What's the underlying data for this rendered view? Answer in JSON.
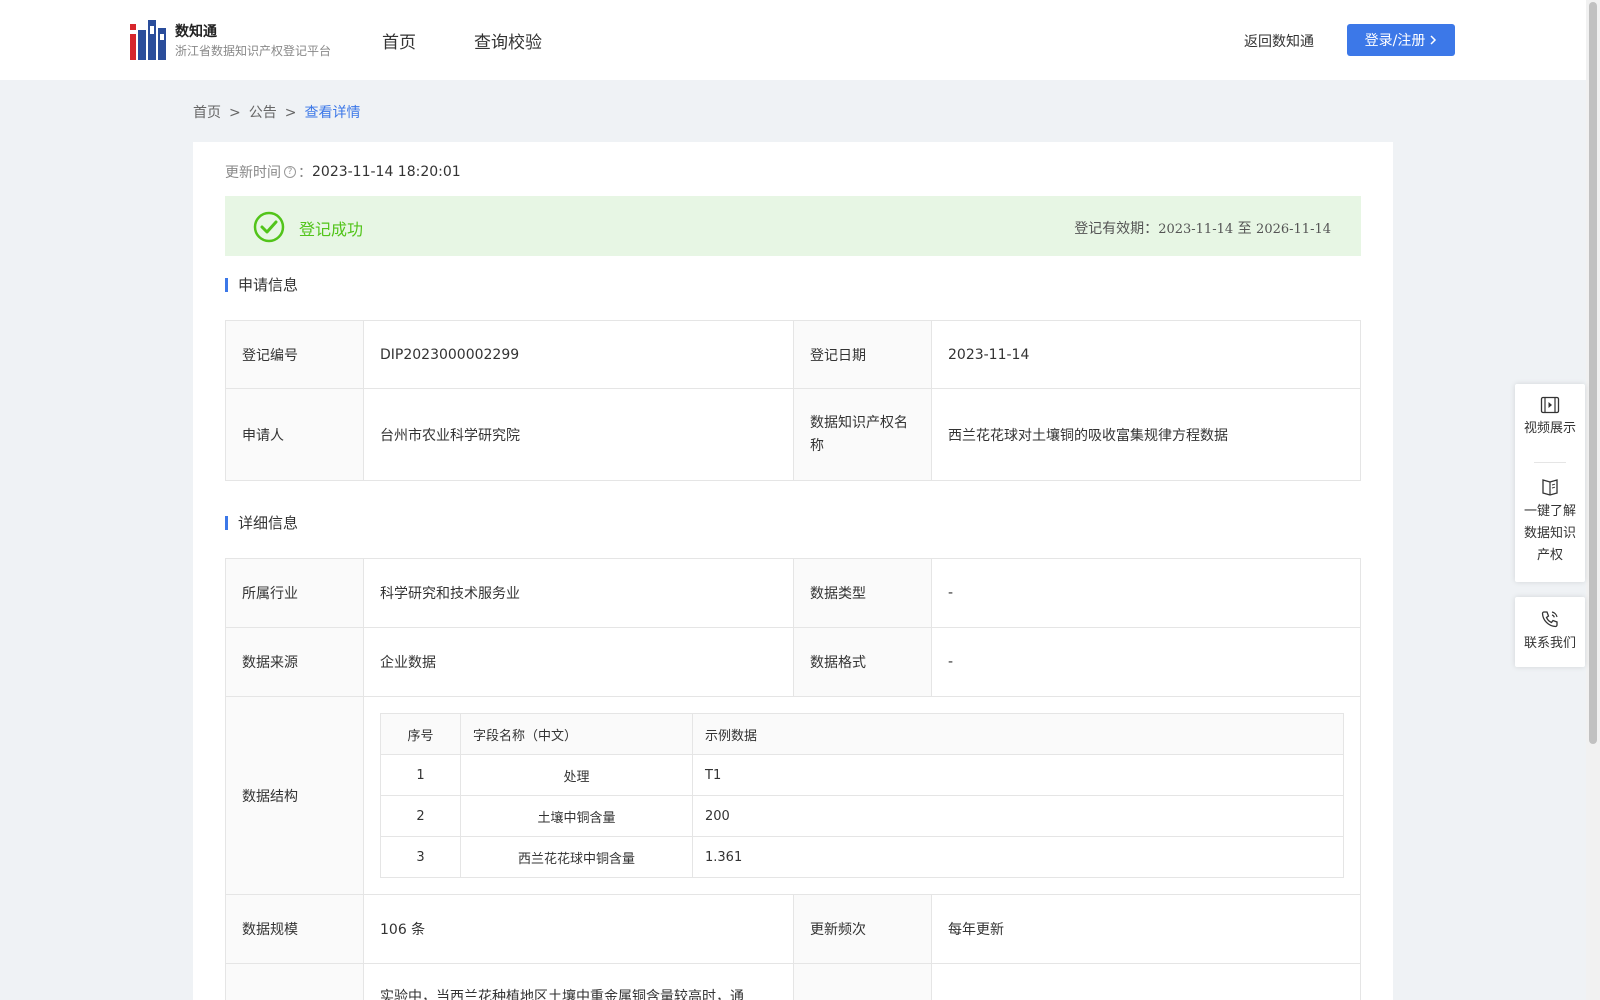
{
  "header": {
    "brand_name": "数知通",
    "brand_sub": "浙江省数据知识产权登记平台",
    "nav": [
      "首页",
      "查询校验"
    ],
    "back_link": "返回数知通",
    "login_label": "登录/注册"
  },
  "breadcrumb": [
    "首页",
    "公告",
    "查看详情"
  ],
  "update": {
    "label": "更新时间",
    "value": "2023-11-14 18:20:01"
  },
  "status": {
    "text": "登记成功",
    "validity_label": "登记有效期：",
    "validity_from": "2023-11-14",
    "validity_to_word": "至",
    "validity_to": "2026-11-14"
  },
  "sections": {
    "apply": "申请信息",
    "detail": "详细信息"
  },
  "apply_info": {
    "reg_no_label": "登记编号",
    "reg_no": "DIP2023000002299",
    "reg_date_label": "登记日期",
    "reg_date": "2023-11-14",
    "applicant_label": "申请人",
    "applicant": "台州市农业科学研究院",
    "name_label": "数据知识产权名称",
    "name": "西兰花花球对土壤铜的吸收富集规律方程数据"
  },
  "detail_info": {
    "industry_label": "所属行业",
    "industry": "科学研究和技术服务业",
    "type_label": "数据类型",
    "type": "-",
    "source_label": "数据来源",
    "source": "企业数据",
    "format_label": "数据格式",
    "format": "-",
    "structure_label": "数据结构",
    "scale_label": "数据规模",
    "scale": "106 条",
    "freq_label": "更新频次",
    "freq": "每年更新",
    "next_text": "实验中，当西兰花种植地区土壤中重金属铜含量较高时，通"
  },
  "structure": {
    "headers": [
      "序号",
      "字段名称（中文）",
      "示例数据"
    ],
    "rows": [
      [
        "1",
        "处理",
        "T1"
      ],
      [
        "2",
        "土壤中铜含量",
        "200"
      ],
      [
        "3",
        "西兰花花球中铜含量",
        "1.361"
      ]
    ]
  },
  "side": {
    "video": "视频展示",
    "learn": [
      "一键了解",
      "数据知识",
      "产权"
    ],
    "contact": "联系我们"
  },
  "colors": {
    "accent": "#3c78e8",
    "success": "#52c41a",
    "success_bg": "#e7f6e4"
  }
}
